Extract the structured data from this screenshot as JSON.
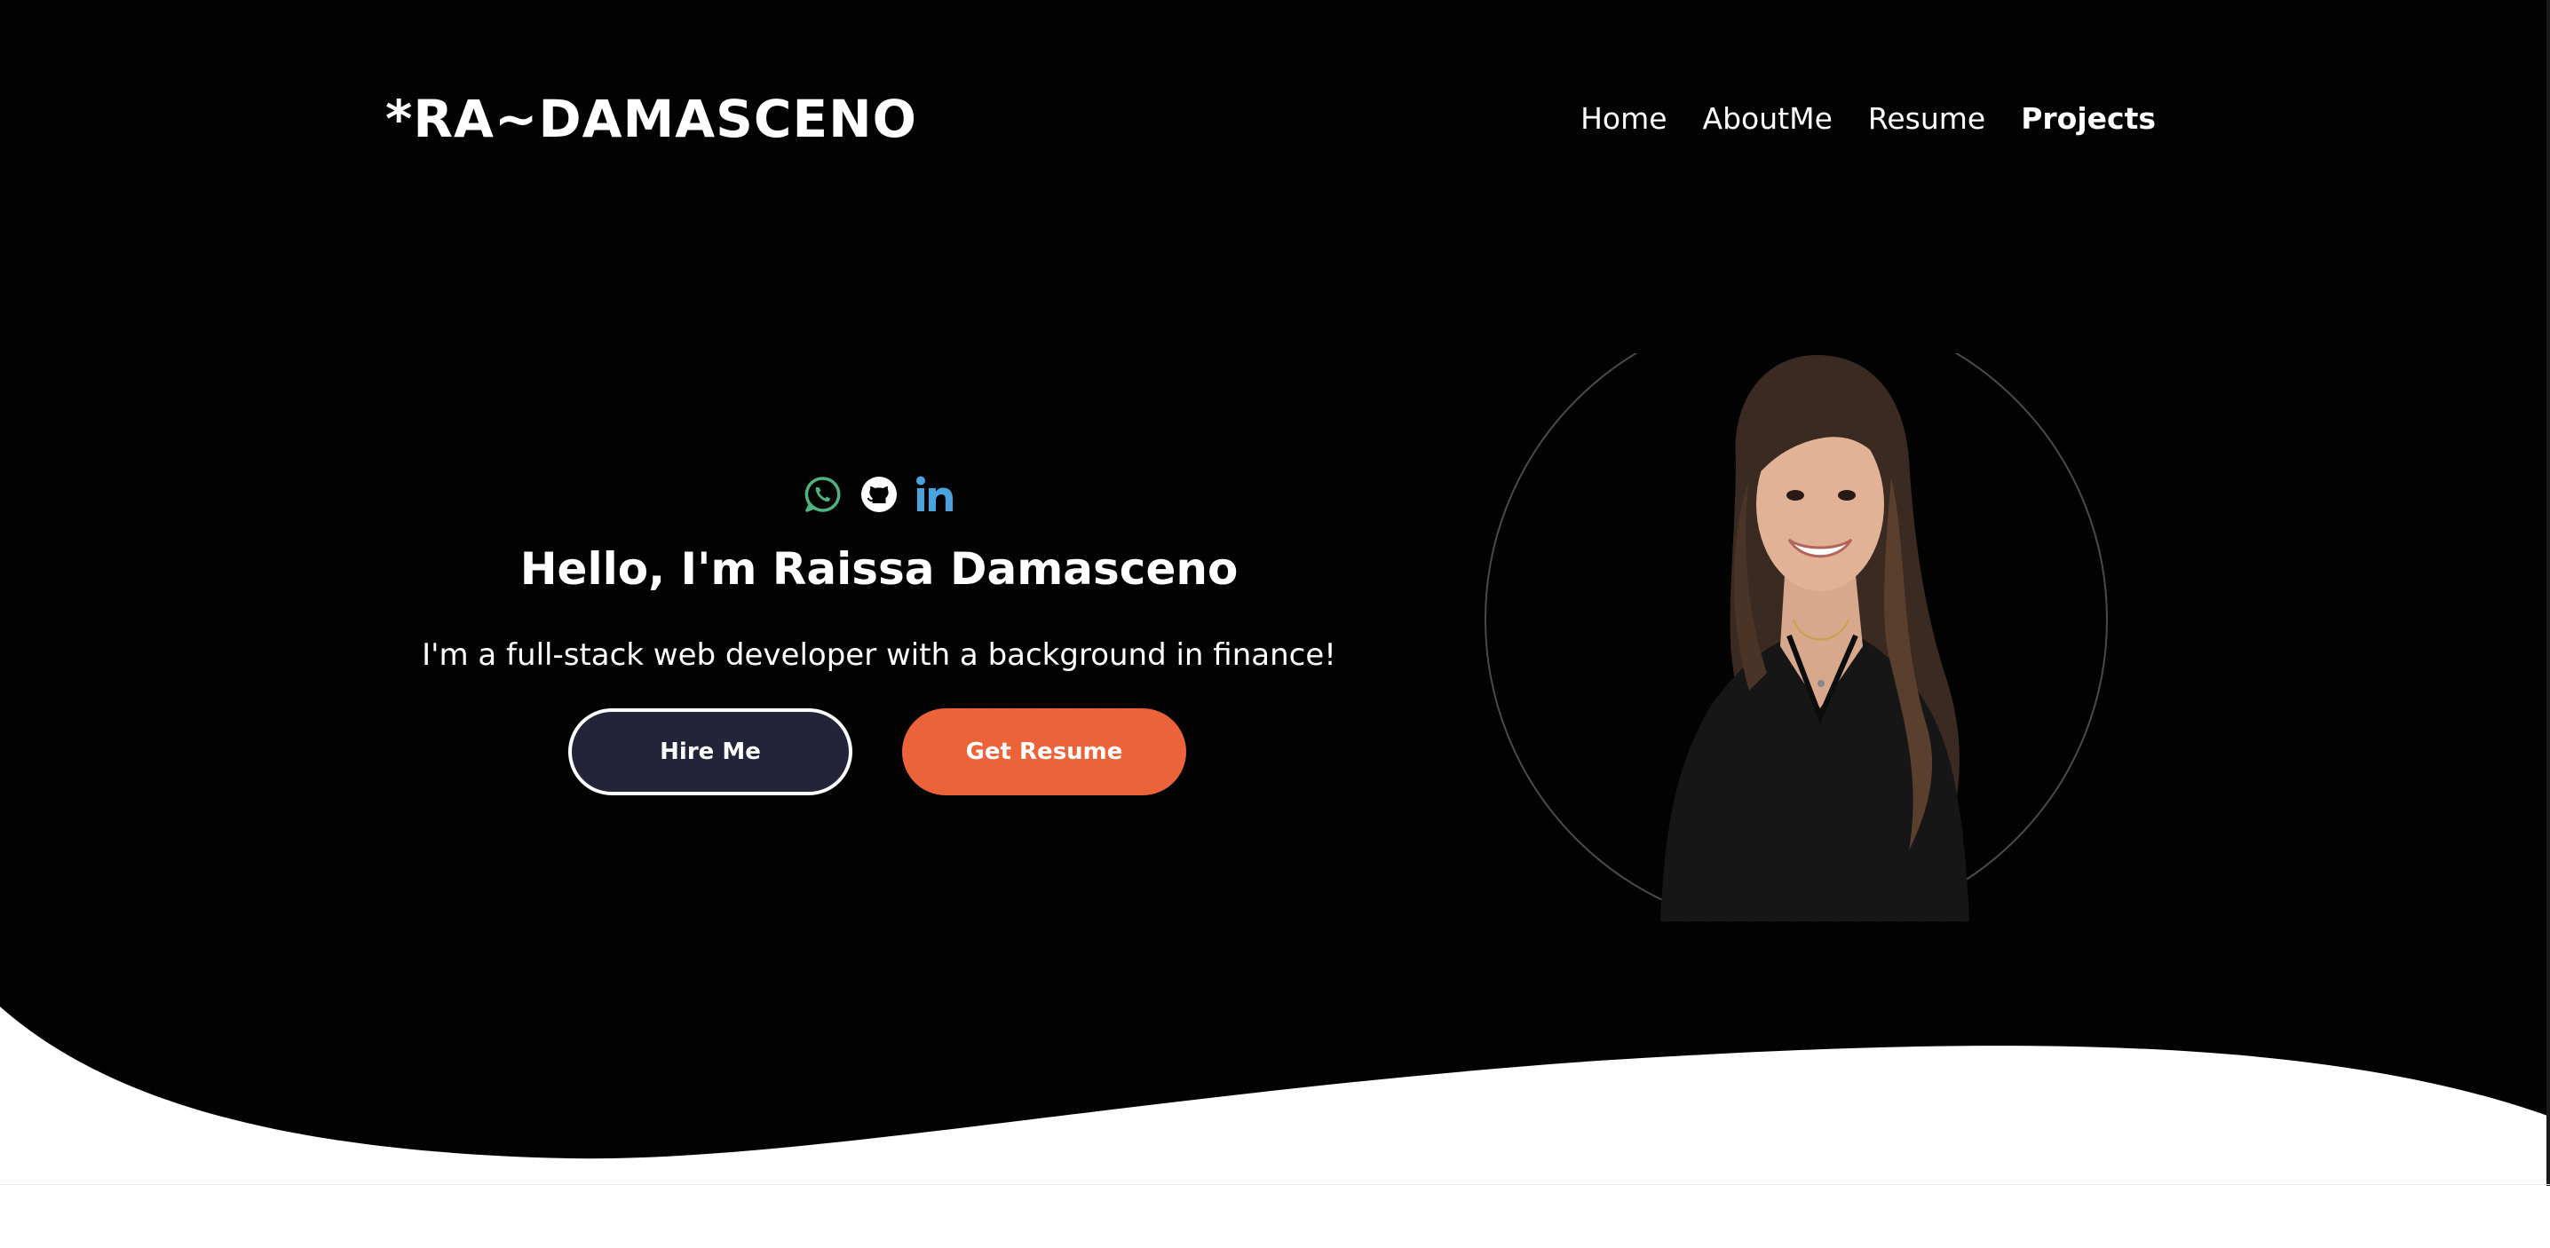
{
  "brand": {
    "logo_text": "*RA~DAMASCENO"
  },
  "nav": {
    "items": [
      {
        "label": "Home",
        "active": false
      },
      {
        "label": "AboutMe",
        "active": false
      },
      {
        "label": "Resume",
        "active": false
      },
      {
        "label": "Projects",
        "active": true
      }
    ]
  },
  "social": {
    "icons": [
      "whatsapp-icon",
      "github-icon",
      "linkedin-icon"
    ],
    "colors": {
      "whatsapp": "#4fb381",
      "github": "#ffffff",
      "linkedin": "#4aa3df"
    }
  },
  "hero": {
    "greeting": "Hello, I'm Raissa Damasceno",
    "tagline": "I'm a full-stack web developer with a background in finance!",
    "hire_button": "Hire Me",
    "resume_button": "Get Resume"
  },
  "colors": {
    "background": "#000000",
    "accent": "#ec6339",
    "hire_button_bg": "#23243a",
    "text": "#ffffff"
  }
}
